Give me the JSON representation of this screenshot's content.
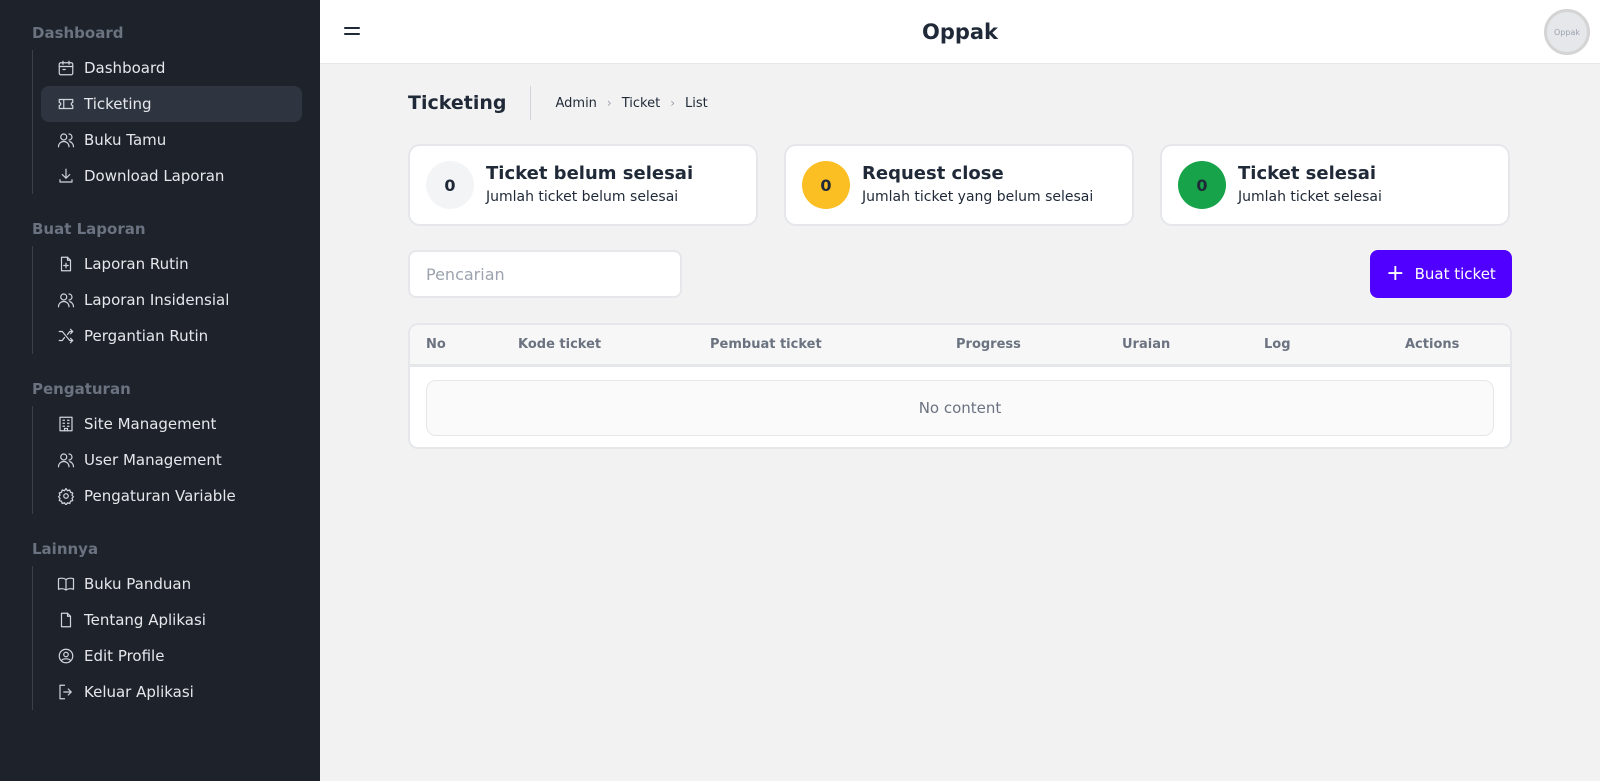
{
  "header": {
    "title": "Oppak",
    "avatar_text": "Oppak"
  },
  "sidebar": {
    "sections": [
      {
        "title": "Dashboard",
        "items": [
          {
            "label": "Dashboard",
            "icon": "calendar-icon"
          },
          {
            "label": "Ticketing",
            "icon": "ticket-icon",
            "active": true
          },
          {
            "label": "Buku Tamu",
            "icon": "users-icon"
          },
          {
            "label": "Download Laporan",
            "icon": "download-icon"
          }
        ]
      },
      {
        "title": "Buat Laporan",
        "items": [
          {
            "label": "Laporan Rutin",
            "icon": "file-plus-icon"
          },
          {
            "label": "Laporan Insidensial",
            "icon": "users-icon"
          },
          {
            "label": "Pergantian Rutin",
            "icon": "shuffle-icon"
          }
        ]
      },
      {
        "title": "Pengaturan",
        "items": [
          {
            "label": "Site Management",
            "icon": "building-icon"
          },
          {
            "label": "User Management",
            "icon": "users-icon"
          },
          {
            "label": "Pengaturan Variable",
            "icon": "gear-icon"
          }
        ]
      },
      {
        "title": "Lainnya",
        "items": [
          {
            "label": "Buku Panduan",
            "icon": "book-icon"
          },
          {
            "label": "Tentang Aplikasi",
            "icon": "file-icon"
          },
          {
            "label": "Edit Profile",
            "icon": "user-circle-icon"
          },
          {
            "label": "Keluar Aplikasi",
            "icon": "logout-icon"
          }
        ]
      }
    ]
  },
  "page": {
    "title": "Ticketing",
    "breadcrumb": [
      "Admin",
      "Ticket",
      "List"
    ]
  },
  "stats": [
    {
      "count": "0",
      "title": "Ticket belum selesai",
      "subtitle": "Jumlah ticket belum selesai",
      "color": "#f3f4f6"
    },
    {
      "count": "0",
      "title": "Request close",
      "subtitle": "Jumlah ticket yang belum selesai",
      "color": "#fbbf24"
    },
    {
      "count": "0",
      "title": "Ticket selesai",
      "subtitle": "Jumlah ticket selesai",
      "color": "#16a34a"
    }
  ],
  "search": {
    "placeholder": "Pencarian",
    "value": ""
  },
  "create_button": {
    "label": "Buat ticket",
    "color": "#4f00ff"
  },
  "table": {
    "columns": [
      "No",
      "Kode ticket",
      "Pembuat ticket",
      "Progress",
      "Uraian",
      "Log",
      "Actions"
    ],
    "empty_text": "No content"
  }
}
